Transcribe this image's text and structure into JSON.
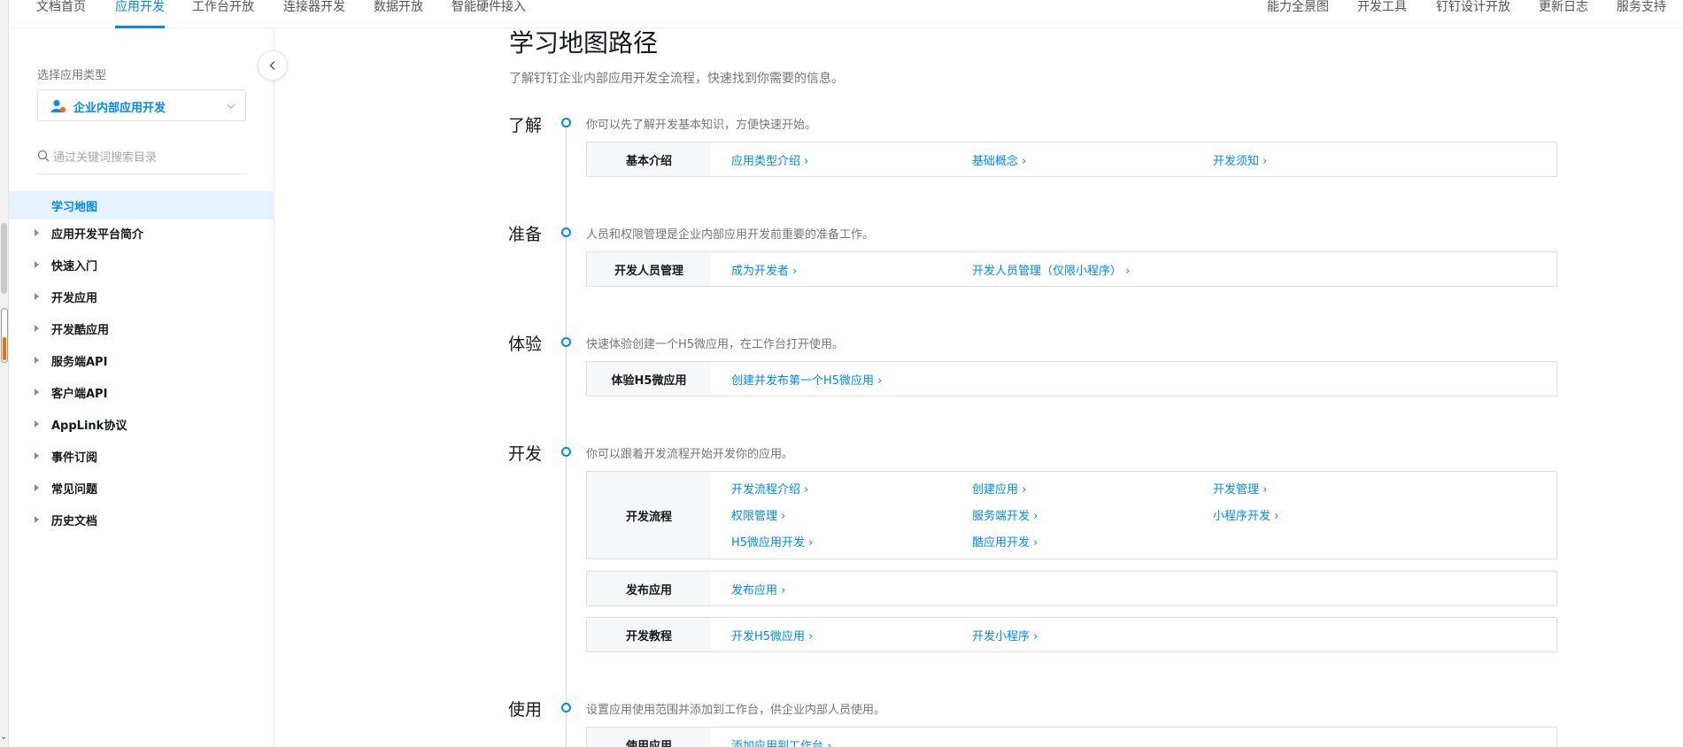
{
  "topnav": {
    "left": [
      "文档首页",
      "应用开发",
      "工作台开放",
      "连接器开发",
      "数据开放",
      "智能硬件接入"
    ],
    "active": "应用开发",
    "right": [
      "能力全景图",
      "开发工具",
      "钉钉设计开放",
      "更新日志",
      "服务支持"
    ]
  },
  "sidebar": {
    "select_label": "选择应用类型",
    "select_value": "企业内部应用开发",
    "search_placeholder": "通过关键词搜索目录",
    "active_item": "学习地图",
    "items": [
      "应用开发平台简介",
      "快速入门",
      "开发应用",
      "开发酷应用",
      "服务端API",
      "客户端API",
      "AppLink协议",
      "事件订阅",
      "常见问题",
      "历史文档"
    ]
  },
  "main": {
    "title": "学习地图路径",
    "subtitle": "了解钉钉企业内部应用开发全流程，快速找到你需要的信息。",
    "sections": [
      {
        "title": "了解",
        "desc": "你可以先了解开发基本知识，方便快速开始。",
        "cards": [
          {
            "label": "基本介绍",
            "links": [
              "应用类型介绍 ›",
              "基础概念 ›",
              "开发须知 ›"
            ]
          }
        ]
      },
      {
        "title": "准备",
        "desc": "人员和权限管理是企业内部应用开发前重要的准备工作。",
        "cards": [
          {
            "label": "开发人员管理",
            "links": [
              "成为开发者 ›",
              "开发人员管理（仅限小程序） ›"
            ]
          }
        ]
      },
      {
        "title": "体验",
        "desc": "快速体验创建一个H5微应用，在工作台打开使用。",
        "cards": [
          {
            "label": "体验H5微应用",
            "links": [
              "创建并发布第一个H5微应用 ›"
            ]
          }
        ]
      },
      {
        "title": "开发",
        "desc": "你可以跟着开发流程开始开发你的应用。",
        "cards": [
          {
            "label": "开发流程",
            "links": [
              "开发流程介绍 ›",
              "创建应用 ›",
              "开发管理 ›",
              "权限管理 ›",
              "服务端开发 ›",
              "小程序开发 ›",
              "H5微应用开发 ›",
              "酷应用开发 ›"
            ]
          },
          {
            "label": "发布应用",
            "links": [
              "发布应用 ›"
            ]
          },
          {
            "label": "开发教程",
            "links": [
              "开发H5微应用 ›",
              "开发小程序 ›"
            ]
          }
        ]
      },
      {
        "title": "使用",
        "desc": "设置应用使用范围并添加到工作台，供企业内部人员使用。",
        "cards": [
          {
            "label": "使用应用",
            "links": [
              "添加应用到工作台 ›"
            ]
          }
        ]
      }
    ]
  },
  "colors": {
    "accent": "#0089ff",
    "active_bg": "#e6f2ff",
    "label_bg": "#f6f7f8"
  }
}
